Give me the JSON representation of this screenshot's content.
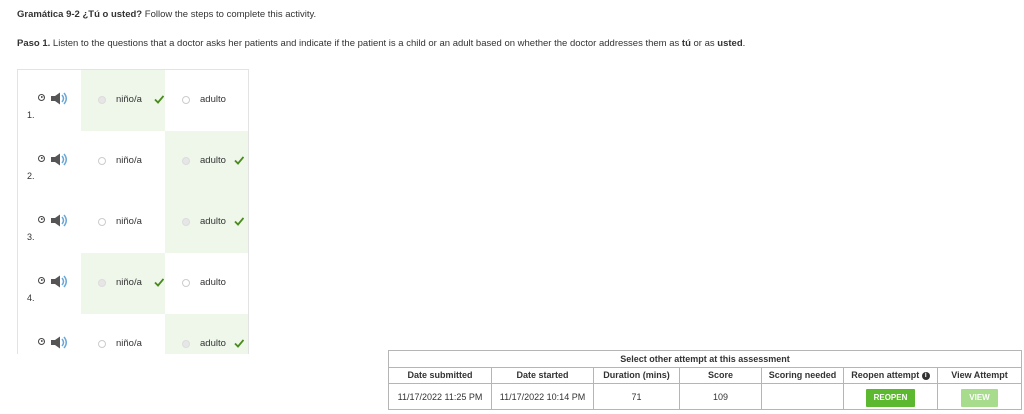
{
  "header": {
    "title_bold": "Gramática 9-2 ¿Tú o usted?",
    "title_rest": " Follow the steps to complete this activity."
  },
  "instructions": {
    "step_label": "Paso 1.",
    "text_a": " Listen to the questions that a doctor asks her patients and indicate if the patient is a child or an adult based on whether the doctor addresses them as ",
    "tu": "tú",
    "text_b": " or as ",
    "usted": "usted",
    "text_c": "."
  },
  "questions": [
    {
      "number": "1.",
      "option_a": "niño/a",
      "option_b": "adulto",
      "selected": "a",
      "correct": "a"
    },
    {
      "number": "2.",
      "option_a": "niño/a",
      "option_b": "adulto",
      "selected": "b",
      "correct": "b"
    },
    {
      "number": "3.",
      "option_a": "niño/a",
      "option_b": "adulto",
      "selected": "b",
      "correct": "b"
    },
    {
      "number": "4.",
      "option_a": "niño/a",
      "option_b": "adulto",
      "selected": "a",
      "correct": "a"
    },
    {
      "number": "",
      "option_a": "niño/a",
      "option_b": "adulto",
      "selected": "b",
      "correct": "b"
    }
  ],
  "icons": {
    "play": "play-circle-icon",
    "speaker": "speaker-icon",
    "check": "checkmark-icon",
    "info": "info-icon"
  },
  "colors": {
    "correct_bg": "#eef7ea",
    "check": "#4a8a1c",
    "reopen_button": "#5cb82e",
    "view_button": "#a6dc8c",
    "speaker": "#6aa7d8"
  },
  "attempts": {
    "title": "Select other attempt at this assessment",
    "headers": {
      "date_submitted": "Date submitted",
      "date_started": "Date started",
      "duration": "Duration (mins)",
      "score": "Score",
      "scoring_needed": "Scoring needed",
      "reopen": "Reopen  attempt",
      "view": "View Attempt"
    },
    "row": {
      "date_submitted": "11/17/2022 11:25 PM",
      "date_started": "11/17/2022 10:14 PM",
      "duration": "71",
      "score": "109",
      "scoring_needed": "",
      "reopen_label": "REOPEN",
      "view_label": "VIEW"
    }
  }
}
